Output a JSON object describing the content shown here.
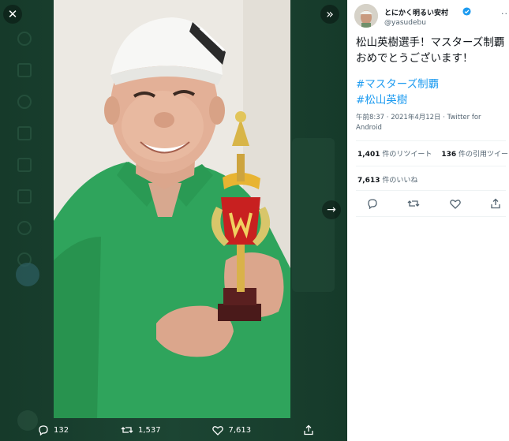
{
  "viewer": {
    "close_icon": "close-icon",
    "collapse_icon": "double-chevron-right-icon",
    "next_icon": "arrow-right-icon",
    "actions": {
      "reply_count": "132",
      "retweet_count": "1,537",
      "like_count": "7,613"
    }
  },
  "tweet": {
    "author_name": "とにかく明るい安村",
    "handle": "@yasudebu",
    "text": "松山英樹選手！マスターズ制覇おめでとうございます！",
    "hashtags": [
      "#マスターズ制覇",
      "#松山英樹"
    ],
    "timestamp": "午前8:37 · 2021年4月12日 · ",
    "source": "Twitter for Android",
    "retweets_num": "1,401",
    "retweets_label": " 件のリツイート",
    "quotes_num": "136",
    "quotes_label": " 件の引用ツイート",
    "likes_num": "7,613",
    "likes_label": " 件のいいね"
  },
  "colors": {
    "link": "#1d9bf0",
    "viewer_bg": "#173b2b",
    "verified": "#1d9bf0",
    "shirt": "#2fa45c"
  }
}
